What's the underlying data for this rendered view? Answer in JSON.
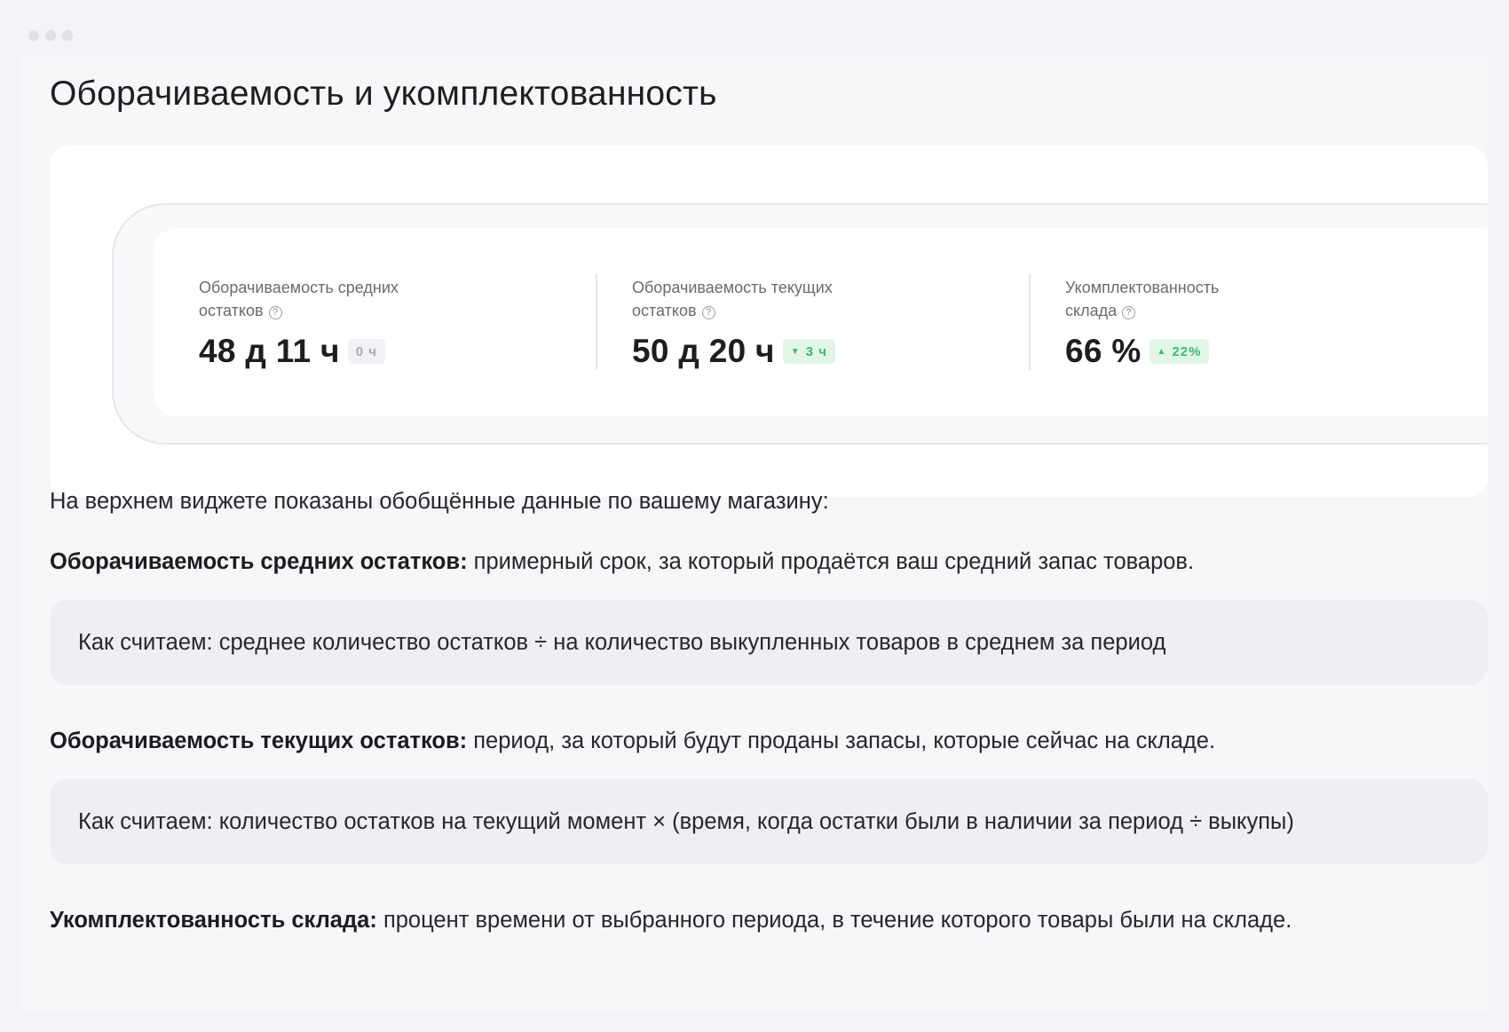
{
  "title": "Оборачиваемость и укомплектованность",
  "widget": {
    "metrics": [
      {
        "label": "Оборачиваемость средних остатков",
        "value": "48 д 11 ч",
        "delta": "0 ч",
        "delta_trend": "neutral",
        "delta_arrow": ""
      },
      {
        "label": "Оборачиваемость текущих остатков",
        "value": "50 д 20 ч",
        "delta": "3 ч",
        "delta_trend": "positive",
        "delta_arrow": "▼"
      },
      {
        "label": "Укомплектованность склада",
        "value": "66 %",
        "delta": "22%",
        "delta_trend": "positive",
        "delta_arrow": "▲"
      }
    ],
    "help_icon": "?"
  },
  "content": {
    "intro": "На верхнем виджете показаны обобщённые данные по вашему магазину:",
    "avg_turnover": {
      "term": "Оборачиваемость средних остатков:",
      "definition": " примерный срок, за который продаётся ваш средний запас товаров.",
      "formula": "Как считаем: среднее количество остатков ÷ на количество выкупленных товаров в среднем за период"
    },
    "current_turnover": {
      "term": "Оборачиваемость текущих остатков:",
      "definition": " период, за который будут проданы запасы, которые сейчас на складе.",
      "formula": "Как считаем: количество остатков на текущий момент × (время, когда остатки были в наличии за период ÷ выкупы)"
    },
    "completeness": {
      "term": "Укомплектованность склада:",
      "definition": " процент времени от выбранного периода, в течение которого товары были на складе."
    }
  },
  "colors": {
    "positive_delta_bg": "#e2f6e8",
    "positive_delta_text": "#3cba6c",
    "neutral_delta_bg": "#f1f2f4",
    "neutral_delta_text": "#a9aab0"
  }
}
